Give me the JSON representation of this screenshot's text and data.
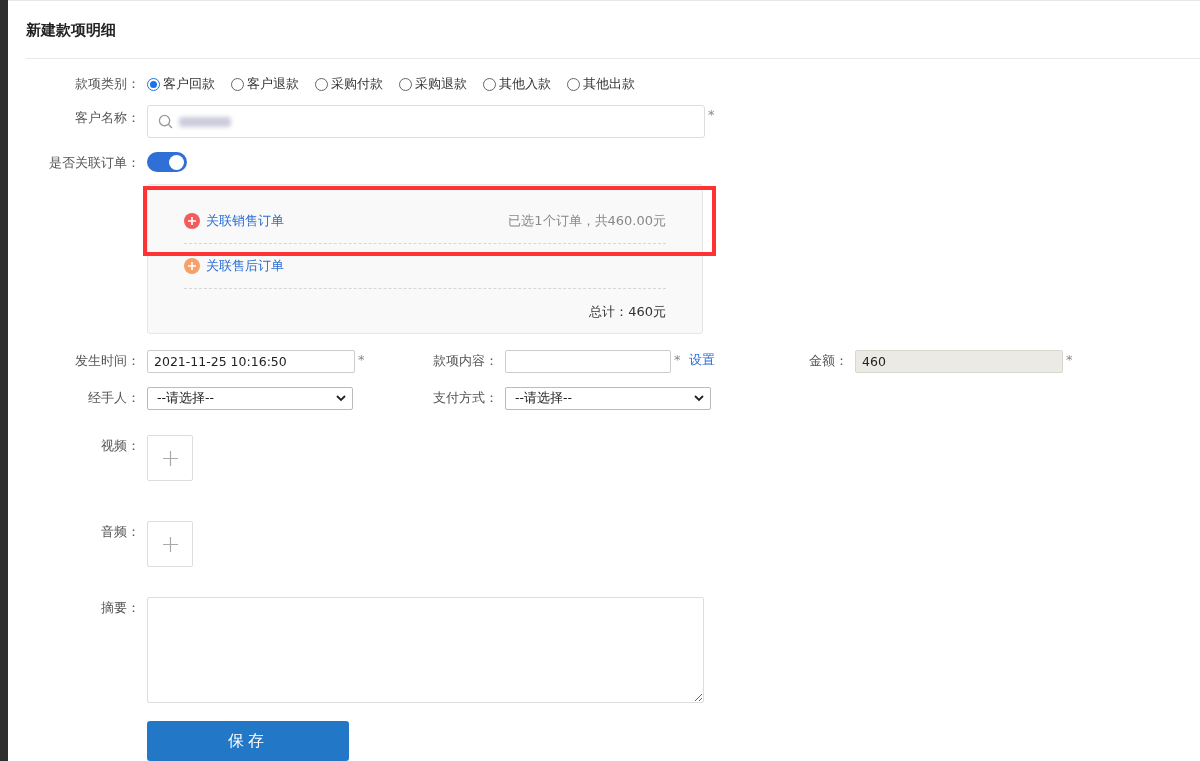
{
  "page_title": "新建款项明细",
  "category": {
    "label": "款项类别：",
    "options": [
      {
        "label": "客户回款",
        "selected": true
      },
      {
        "label": "客户退款",
        "selected": false
      },
      {
        "label": "采购付款",
        "selected": false
      },
      {
        "label": "采购退款",
        "selected": false
      },
      {
        "label": "其他入款",
        "selected": false
      },
      {
        "label": "其他出款",
        "selected": false
      }
    ]
  },
  "customer": {
    "label": "客户名称：",
    "required_mark": "*"
  },
  "link_order": {
    "label": "是否关联订单：",
    "on": true
  },
  "order_links": [
    {
      "kind": "sales",
      "label": "关联销售订单",
      "summary": "已选1个订单，共460.00元",
      "highlighted": true
    },
    {
      "kind": "after_sales",
      "label": "关联售后订单",
      "highlighted": false
    }
  ],
  "total": "总计：460元",
  "date": {
    "label": "发生时间：",
    "value": "2021-11-25 10:16:50",
    "required_mark": "*"
  },
  "content": {
    "label": "款项内容：",
    "required_mark": "*",
    "link": "设置"
  },
  "amount": {
    "label": "金额：",
    "value": "460",
    "required_mark": "*",
    "disabled": true
  },
  "handler": {
    "label": "经手人：",
    "value": "--请选择--"
  },
  "payment": {
    "label": "支付方式：",
    "value": "--请选择--"
  },
  "uploads": [
    {
      "label": "视频："
    },
    {
      "label": "音频："
    }
  ],
  "summary": {
    "label": "摘要："
  },
  "save_button": "保存"
}
